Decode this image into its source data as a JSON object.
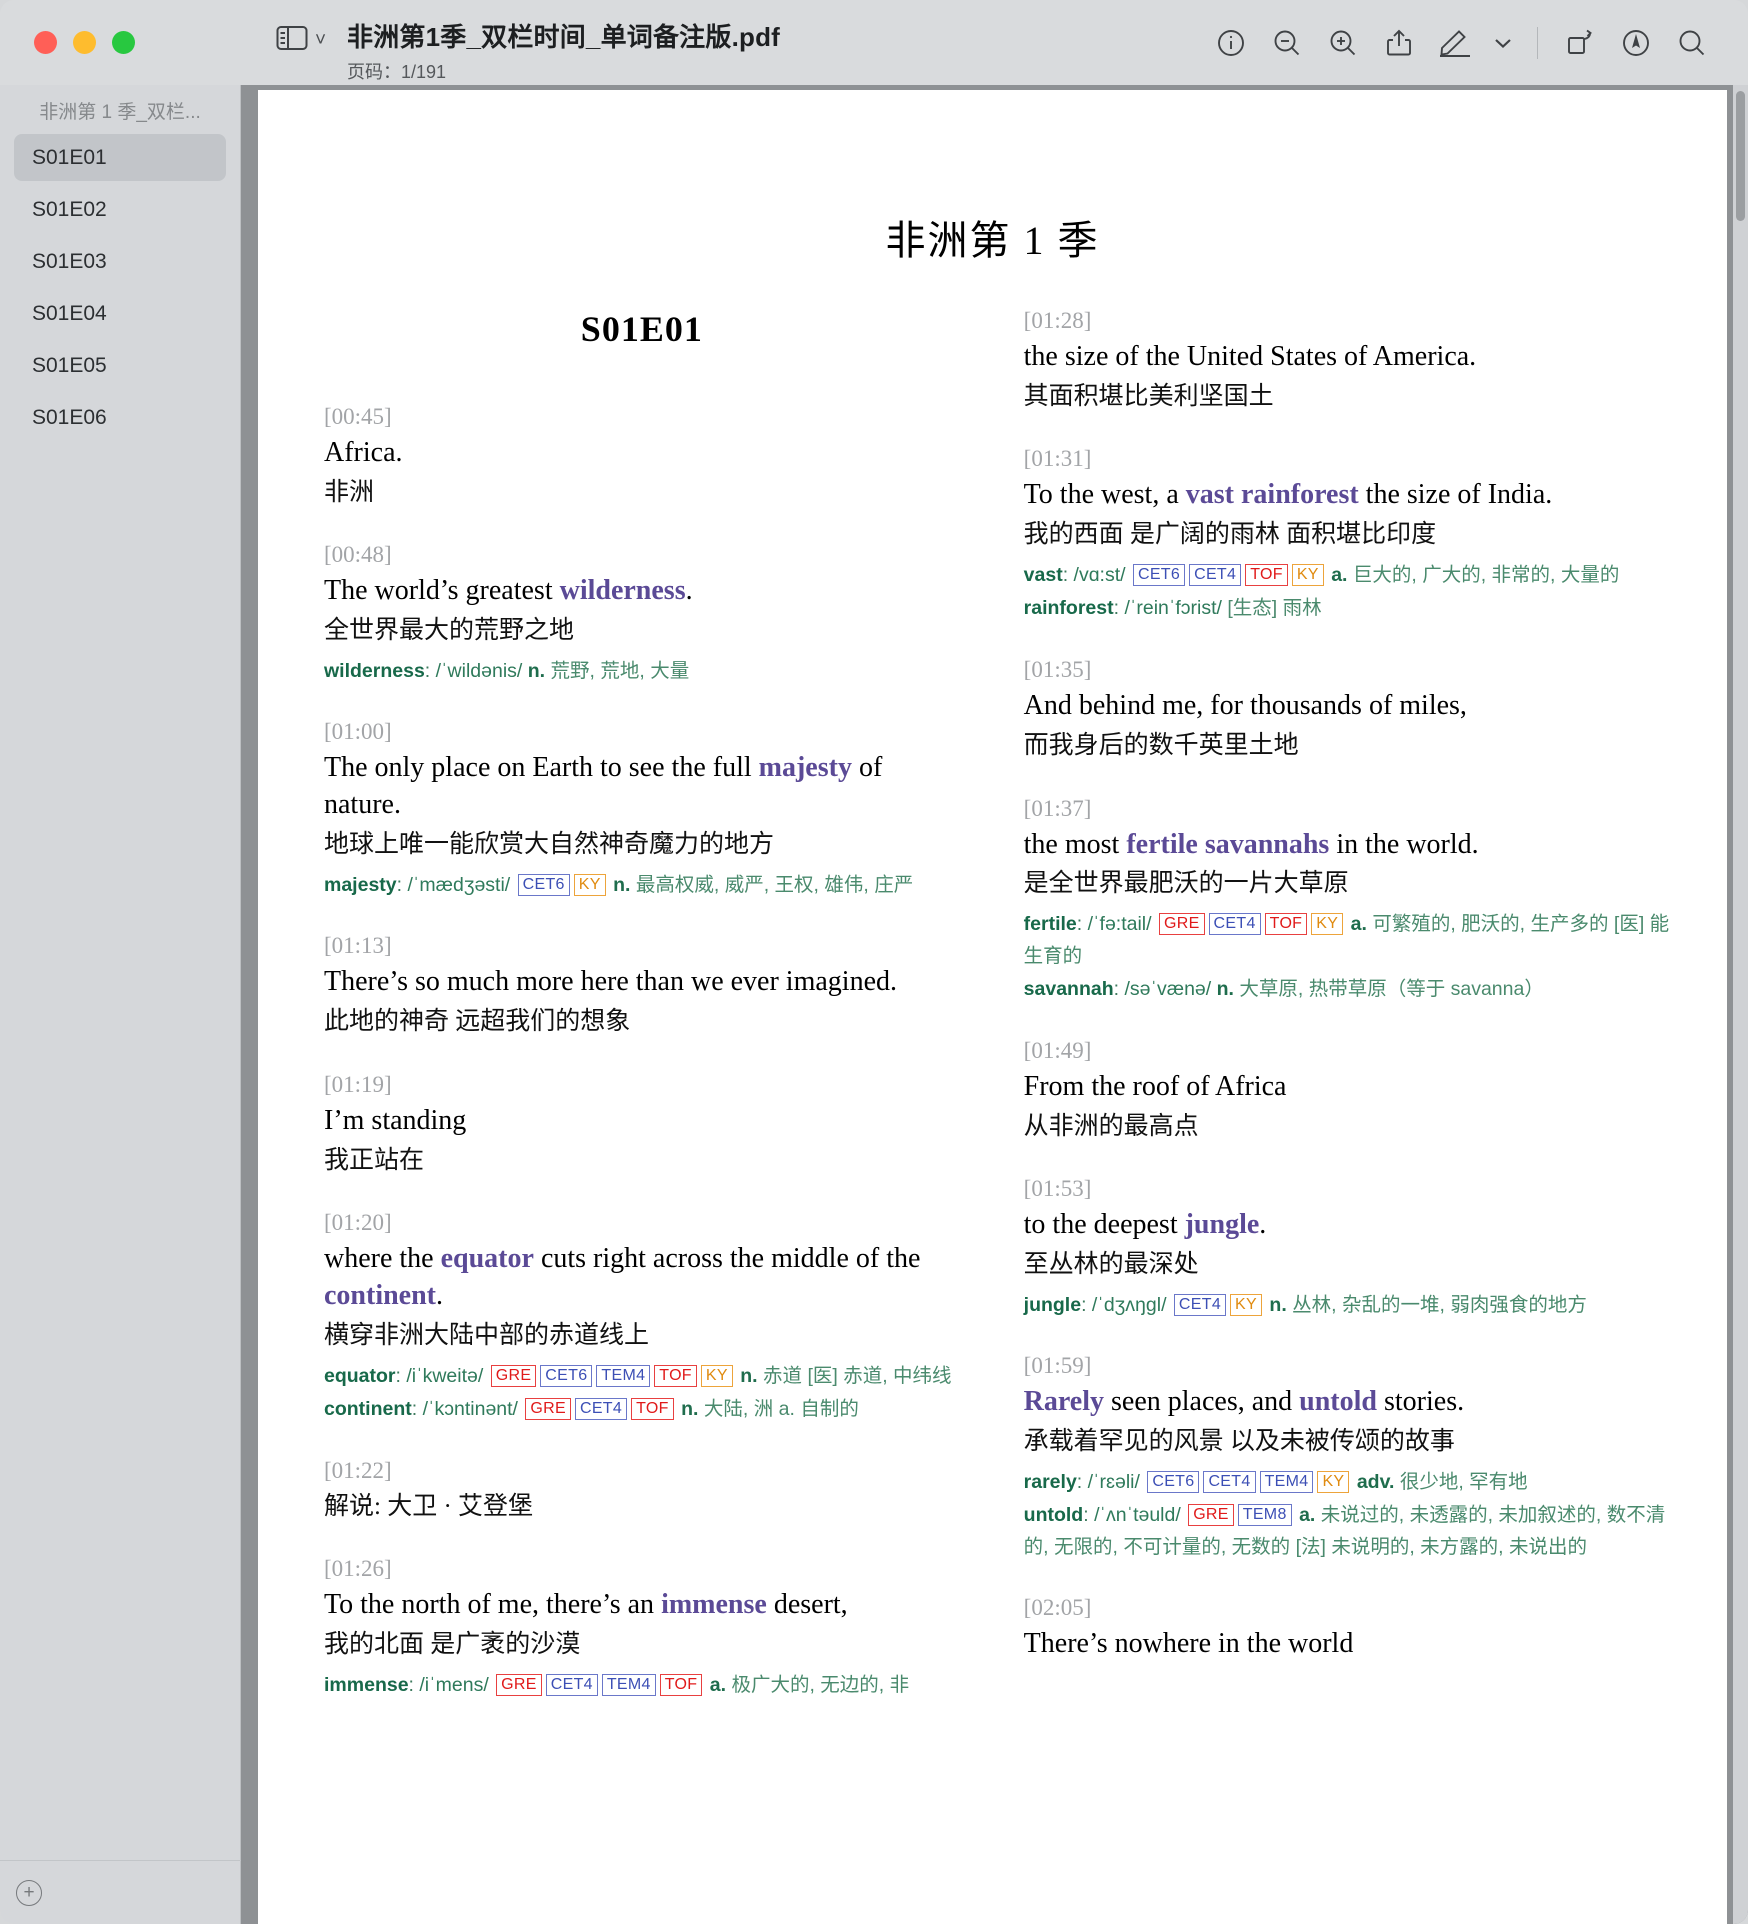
{
  "titlebar": {
    "document_title": "非洲第1季_双栏时间_单词备注版.pdf",
    "page_indicator": "页码：1/191",
    "sidebar_toggle_icon": "sidebar-icon",
    "chevron": "˅",
    "icons": [
      {
        "name": "info-icon",
        "label": "Info"
      },
      {
        "name": "zoom-out-icon",
        "label": "Zoom Out"
      },
      {
        "name": "zoom-in-icon",
        "label": "Zoom In"
      },
      {
        "name": "share-icon",
        "label": "Share"
      },
      {
        "name": "markup-icon",
        "label": "Markup"
      },
      {
        "name": "chevron-down-icon",
        "label": "More"
      },
      {
        "name": "rotate-icon",
        "label": "Rotate"
      },
      {
        "name": "annotate-icon",
        "label": "Annotate"
      },
      {
        "name": "search-icon",
        "label": "Search"
      }
    ]
  },
  "sidebar": {
    "header": "非洲第 1 季_双栏...",
    "items": [
      {
        "label": "S01E01",
        "active": true
      },
      {
        "label": "S01E02",
        "active": false
      },
      {
        "label": "S01E03",
        "active": false
      },
      {
        "label": "S01E04",
        "active": false
      },
      {
        "label": "S01E05",
        "active": false
      },
      {
        "label": "S01E06",
        "active": false
      }
    ],
    "add_button": "+"
  },
  "document": {
    "title": "非洲第 1 季",
    "episode_title": "S01E01",
    "left_column": [
      {
        "ts": "[00:45]",
        "en_pre": "Africa.",
        "en_hl": "",
        "en_post": "",
        "zh": "非洲",
        "defs": []
      },
      {
        "ts": "[00:48]",
        "en_pre": "The world’s greatest ",
        "en_hl": "wilderness",
        "en_post": ".",
        "zh": "全世界最大的荒野之地",
        "defs": [
          {
            "hw": "wilderness",
            "ipa": "/ˈwildənis/",
            "badges": [],
            "pos": "n.",
            "cn": "荒野, 荒地, 大量"
          }
        ]
      },
      {
        "ts": "[01:00]",
        "en_pre": "The only place on Earth to see the full ",
        "en_hl": "majesty",
        "en_post": " of nature.",
        "zh": "地球上唯一能欣赏大自然神奇魔力的地方",
        "defs": [
          {
            "hw": "majesty",
            "ipa": "/ˈmædʒəsti/",
            "badges": [
              [
                "CET6",
                "blue"
              ],
              [
                "KY",
                "org"
              ]
            ],
            "pos": "n.",
            "cn": "最高权威, 威严, 王权, 雄伟, 庄严"
          }
        ]
      },
      {
        "ts": "[01:13]",
        "en_pre": "There’s so much more here than we ever imagined.",
        "en_hl": "",
        "en_post": "",
        "zh": "此地的神奇 远超我们的想象",
        "defs": []
      },
      {
        "ts": "[01:19]",
        "en_pre": "I’m standing",
        "en_hl": "",
        "en_post": "",
        "zh": "我正站在",
        "defs": []
      },
      {
        "ts": "[01:20]",
        "en_pre": "where the ",
        "en_hl": "equator",
        "en_post": " cuts right across the middle of the ",
        "en_hl2": "continent",
        "en_post2": ".",
        "zh": "横穿非洲大陆中部的赤道线上",
        "defs": [
          {
            "hw": "equator",
            "ipa": "/iˈkweitə/",
            "badges": [
              [
                "GRE",
                "red"
              ],
              [
                "CET6",
                "blue"
              ],
              [
                "TEM4",
                "blue"
              ],
              [
                "TOF",
                "red"
              ],
              [
                "KY",
                "org"
              ]
            ],
            "pos": "n.",
            "cn": "赤道 [医] 赤道, 中纬线"
          },
          {
            "hw": "continent",
            "ipa": "/ˈkɔntinənt/",
            "badges": [
              [
                "GRE",
                "red"
              ],
              [
                "CET4",
                "blue"
              ],
              [
                "TOF",
                "red"
              ]
            ],
            "pos": "n.",
            "cn": "大陆, 洲 a. 自制的"
          }
        ]
      },
      {
        "ts": "[01:22]",
        "en_pre": "",
        "en_hl": "",
        "en_post": "",
        "zh": "解说: 大卫 · 艾登堡",
        "defs": []
      },
      {
        "ts": "[01:26]",
        "en_pre": "To the north of me, there’s an ",
        "en_hl": "immense",
        "en_post": " desert,",
        "zh": "我的北面 是广袤的沙漠",
        "defs": [
          {
            "hw": "immense",
            "ipa": "/iˈmens/",
            "badges": [
              [
                "GRE",
                "red"
              ],
              [
                "CET4",
                "blue"
              ],
              [
                "TEM4",
                "blue"
              ],
              [
                "TOF",
                "red"
              ]
            ],
            "pos": "a.",
            "cn": "极广大的, 无边的, 非"
          }
        ]
      }
    ],
    "right_column": [
      {
        "ts": "[01:28]",
        "en_pre": "the size of the United States of America.",
        "en_hl": "",
        "en_post": "",
        "zh": "其面积堪比美利坚国土",
        "defs": []
      },
      {
        "ts": "[01:31]",
        "en_pre": "To the west, a ",
        "en_hl": "vast rainforest",
        "en_post": " the size of India.",
        "zh": "我的西面 是广阔的雨林 面积堪比印度",
        "defs": [
          {
            "hw": "vast",
            "ipa": "/vɑ:st/",
            "badges": [
              [
                "CET6",
                "blue"
              ],
              [
                "CET4",
                "blue"
              ],
              [
                "TOF",
                "red"
              ],
              [
                "KY",
                "org"
              ]
            ],
            "pos": "a.",
            "cn": "巨大的, 广大的, 非常的, 大量的"
          },
          {
            "hw": "rainforest",
            "ipa": "/ˈreinˈfɔrist/",
            "badges": [],
            "pos": "",
            "cn": "[生态] 雨林"
          }
        ]
      },
      {
        "ts": "[01:35]",
        "en_pre": "And behind me, for thousands of miles,",
        "en_hl": "",
        "en_post": "",
        "zh": "而我身后的数千英里土地",
        "defs": []
      },
      {
        "ts": "[01:37]",
        "en_pre": "the most ",
        "en_hl": "fertile savannahs",
        "en_post": " in the world.",
        "zh": "是全世界最肥沃的一片大草原",
        "defs": [
          {
            "hw": "fertile",
            "ipa": "/ˈfə:tail/",
            "badges": [
              [
                "GRE",
                "red"
              ],
              [
                "CET4",
                "blue"
              ],
              [
                "TOF",
                "red"
              ],
              [
                "KY",
                "org"
              ]
            ],
            "pos": "a.",
            "cn": "可繁殖的, 肥沃的, 生产多的 [医] 能生育的"
          },
          {
            "hw": "savannah",
            "ipa": "/səˈvænə/",
            "badges": [],
            "pos": "n.",
            "cn": "大草原, 热带草原（等于 savanna）"
          }
        ]
      },
      {
        "ts": "[01:49]",
        "en_pre": "From the roof of Africa",
        "en_hl": "",
        "en_post": "",
        "zh": "从非洲的最高点",
        "defs": []
      },
      {
        "ts": "[01:53]",
        "en_pre": "to the deepest ",
        "en_hl": "jungle",
        "en_post": ".",
        "zh": "至丛林的最深处",
        "defs": [
          {
            "hw": "jungle",
            "ipa": "/ˈdʒʌŋgl/",
            "badges": [
              [
                "CET4",
                "blue"
              ],
              [
                "KY",
                "org"
              ]
            ],
            "pos": "n.",
            "cn": "丛林, 杂乱的一堆, 弱肉强食的地方"
          }
        ]
      },
      {
        "ts": "[01:59]",
        "en_pre": "",
        "en_hl": "Rarely",
        "en_post": " seen places, and ",
        "en_hl2": "untold",
        "en_post2": " stories.",
        "zh": "承载着罕见的风景 以及未被传颂的故事",
        "defs": [
          {
            "hw": "rarely",
            "ipa": "/ˈrɛəli/",
            "badges": [
              [
                "CET6",
                "blue"
              ],
              [
                "CET4",
                "blue"
              ],
              [
                "TEM4",
                "blue"
              ],
              [
                "KY",
                "org"
              ]
            ],
            "pos": "adv.",
            "cn": "很少地, 罕有地"
          },
          {
            "hw": "untold",
            "ipa": "/ˈʌnˈtəuld/",
            "badges": [
              [
                "GRE",
                "red"
              ],
              [
                "TEM8",
                "blue"
              ]
            ],
            "pos": "a.",
            "cn": "未说过的, 未透露的, 未加叙述的, 数不清的, 无限的, 不可计量的, 无数的 [法] 未说明的, 未方露的, 未说出的"
          }
        ]
      },
      {
        "ts": "[02:05]",
        "en_pre": "There’s nowhere in the world",
        "en_hl": "",
        "en_post": "",
        "zh": "",
        "defs": []
      }
    ]
  },
  "colors": {
    "highlight_word": "#5b4a96",
    "definition_green": "#3e7a5e",
    "badge_blue": "#3c4fb5",
    "badge_red": "#e01a1a",
    "badge_orange": "#e08b10",
    "timestamp_gray": "#a2a4a7"
  }
}
